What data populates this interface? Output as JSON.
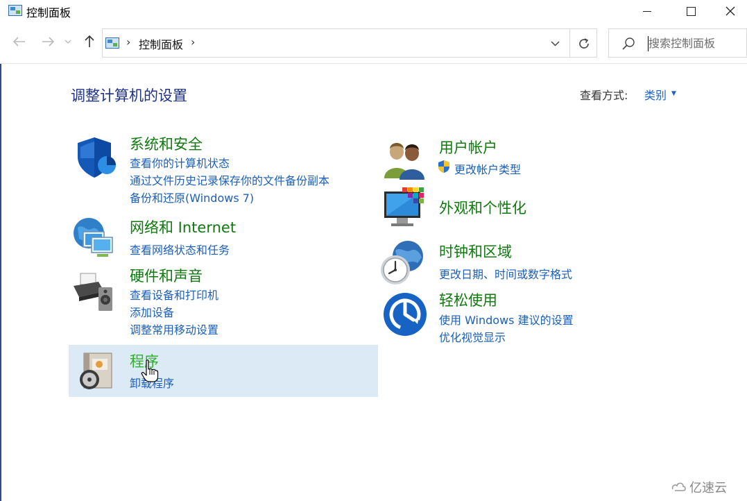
{
  "window": {
    "title": "控制面板",
    "minimize_label": "",
    "maximize_label": "",
    "close_label": "✕"
  },
  "nav": {
    "back_glyph": "←",
    "forward_glyph": "→",
    "recent_glyph": "⌄",
    "up_glyph": "↑"
  },
  "address": {
    "separator": "›",
    "crumb": "控制面板",
    "dropdown_glyph": "⌄",
    "refresh_glyph": "↻"
  },
  "search": {
    "placeholder": "搜索控制面板",
    "value": ""
  },
  "header": {
    "title": "调整计算机的设置",
    "view_label": "查看方式:",
    "view_value": "类别",
    "view_arrow": "▼"
  },
  "categories_left": [
    {
      "title": "系统和安全",
      "icon": "shield-icon",
      "links": [
        "查看你的计算机状态",
        "通过文件历史记录保存你的文件备份副本",
        "备份和还原(Windows 7)"
      ]
    },
    {
      "title": "网络和 Internet",
      "icon": "network-globe-icon",
      "links": [
        "查看网络状态和任务"
      ]
    },
    {
      "title": "硬件和声音",
      "icon": "printer-speaker-icon",
      "links": [
        "查看设备和打印机",
        "添加设备",
        "调整常用移动设置"
      ]
    },
    {
      "title": "程序",
      "icon": "programs-disc-icon",
      "links": [
        "卸载程序"
      ],
      "hovered": true
    }
  ],
  "categories_right": [
    {
      "title": "用户帐户",
      "icon": "users-icon",
      "links": [
        "更改帐户类型"
      ]
    },
    {
      "title": "外观和个性化",
      "icon": "monitor-palette-icon",
      "links": []
    },
    {
      "title": "时钟和区域",
      "icon": "clock-globe-icon",
      "links": [
        "更改日期、时间或数字格式"
      ]
    },
    {
      "title": "轻松使用",
      "icon": "ease-of-access-icon",
      "links": [
        "使用 Windows 建议的设置",
        "优化视觉显示"
      ]
    }
  ],
  "watermark": {
    "text": "亿速云"
  },
  "colors": {
    "category_title": "#0e7a0d",
    "category_title_hover": "#2fb12c",
    "link": "#1b5fba",
    "page_title": "#1e3287",
    "hover_bg": "#dceaf6"
  }
}
